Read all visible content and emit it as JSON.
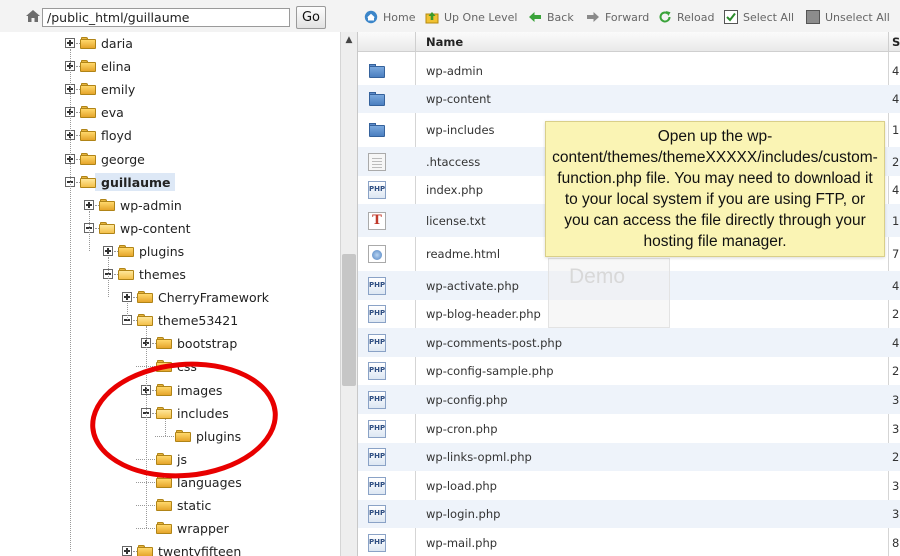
{
  "left_pane": {
    "path_value": "/public_html/guillaume",
    "go_label": "Go",
    "tree": [
      {
        "label": "daria",
        "level": 0,
        "expander": "plus",
        "open": false,
        "bold": false,
        "selected": false
      },
      {
        "label": "elina",
        "level": 0,
        "expander": "plus",
        "open": false,
        "bold": false,
        "selected": false
      },
      {
        "label": "emily",
        "level": 0,
        "expander": "plus",
        "open": false,
        "bold": false,
        "selected": false
      },
      {
        "label": "eva",
        "level": 0,
        "expander": "plus",
        "open": false,
        "bold": false,
        "selected": false
      },
      {
        "label": "floyd",
        "level": 0,
        "expander": "plus",
        "open": false,
        "bold": false,
        "selected": false
      },
      {
        "label": "george",
        "level": 0,
        "expander": "plus",
        "open": false,
        "bold": false,
        "selected": false
      },
      {
        "label": "guillaume",
        "level": 0,
        "expander": "minus",
        "open": true,
        "bold": true,
        "selected": true
      },
      {
        "label": "wp-admin",
        "level": 1,
        "expander": "plus",
        "open": false,
        "bold": false,
        "selected": false
      },
      {
        "label": "wp-content",
        "level": 1,
        "expander": "minus",
        "open": true,
        "bold": false,
        "selected": false
      },
      {
        "label": "plugins",
        "level": 2,
        "expander": "plus",
        "open": false,
        "bold": false,
        "selected": false
      },
      {
        "label": "themes",
        "level": 2,
        "expander": "minus",
        "open": true,
        "bold": false,
        "selected": false
      },
      {
        "label": "CherryFramework",
        "level": 3,
        "expander": "plus",
        "open": false,
        "bold": false,
        "selected": false
      },
      {
        "label": "theme53421",
        "level": 3,
        "expander": "minus",
        "open": true,
        "bold": false,
        "selected": false
      },
      {
        "label": "bootstrap",
        "level": 4,
        "expander": "plus",
        "open": false,
        "bold": false,
        "selected": false
      },
      {
        "label": "css",
        "level": 4,
        "expander": "none",
        "open": false,
        "bold": false,
        "selected": false
      },
      {
        "label": "images",
        "level": 4,
        "expander": "plus",
        "open": false,
        "bold": false,
        "selected": false
      },
      {
        "label": "includes",
        "level": 4,
        "expander": "minus",
        "open": true,
        "bold": false,
        "selected": false
      },
      {
        "label": "plugins",
        "level": 5,
        "expander": "none",
        "open": false,
        "bold": false,
        "selected": false
      },
      {
        "label": "js",
        "level": 4,
        "expander": "none",
        "open": false,
        "bold": false,
        "selected": false
      },
      {
        "label": "languages",
        "level": 4,
        "expander": "none",
        "open": false,
        "bold": false,
        "selected": false
      },
      {
        "label": "static",
        "level": 4,
        "expander": "none",
        "open": false,
        "bold": false,
        "selected": false
      },
      {
        "label": "wrapper",
        "level": 4,
        "expander": "none",
        "open": false,
        "bold": false,
        "selected": false
      },
      {
        "label": "twentyfifteen",
        "level": 3,
        "expander": "plus",
        "open": false,
        "bold": false,
        "selected": false
      }
    ]
  },
  "toolbar": {
    "home": "Home",
    "up": "Up One Level",
    "back": "Back",
    "forward": "Forward",
    "reload": "Reload",
    "select_all": "Select All",
    "unselect_all": "Unselect All"
  },
  "grid": {
    "col_name": "Name",
    "col_size": "S",
    "rows": [
      {
        "icon": "folder",
        "name": "wp-admin",
        "size": "4"
      },
      {
        "icon": "folder",
        "name": "wp-content",
        "size": "4"
      },
      {
        "icon": "folder",
        "name": "wp-includes",
        "size": "1"
      },
      {
        "icon": "doc",
        "name": ".htaccess",
        "size": "2"
      },
      {
        "icon": "php",
        "name": "index.php",
        "size": "4"
      },
      {
        "icon": "txt",
        "name": "license.txt",
        "size": "1"
      },
      {
        "icon": "html",
        "name": "readme.html",
        "size": "7"
      },
      {
        "icon": "php",
        "name": "wp-activate.php",
        "size": "4"
      },
      {
        "icon": "php",
        "name": "wp-blog-header.php",
        "size": "2"
      },
      {
        "icon": "php",
        "name": "wp-comments-post.php",
        "size": "4"
      },
      {
        "icon": "php",
        "name": "wp-config-sample.php",
        "size": "2"
      },
      {
        "icon": "php",
        "name": "wp-config.php",
        "size": "3"
      },
      {
        "icon": "php",
        "name": "wp-cron.php",
        "size": "3"
      },
      {
        "icon": "php",
        "name": "wp-links-opml.php",
        "size": "2"
      },
      {
        "icon": "php",
        "name": "wp-load.php",
        "size": "3"
      },
      {
        "icon": "php",
        "name": "wp-login.php",
        "size": "3"
      },
      {
        "icon": "php",
        "name": "wp-mail.php",
        "size": "8"
      }
    ]
  },
  "callout_text": "Open up the wp-content/themes/themeXXXXX/includes/custom-function.php file. You may need to download it to your local system if you are using FTP, or you can access the file directly through your hosting file manager.",
  "ghost_text": "Demo",
  "colors": {
    "annotation": "#e80000",
    "callout_bg": "#faf4b2",
    "row_alt": "#eef3fa",
    "selected_bg": "#dde8f6"
  }
}
